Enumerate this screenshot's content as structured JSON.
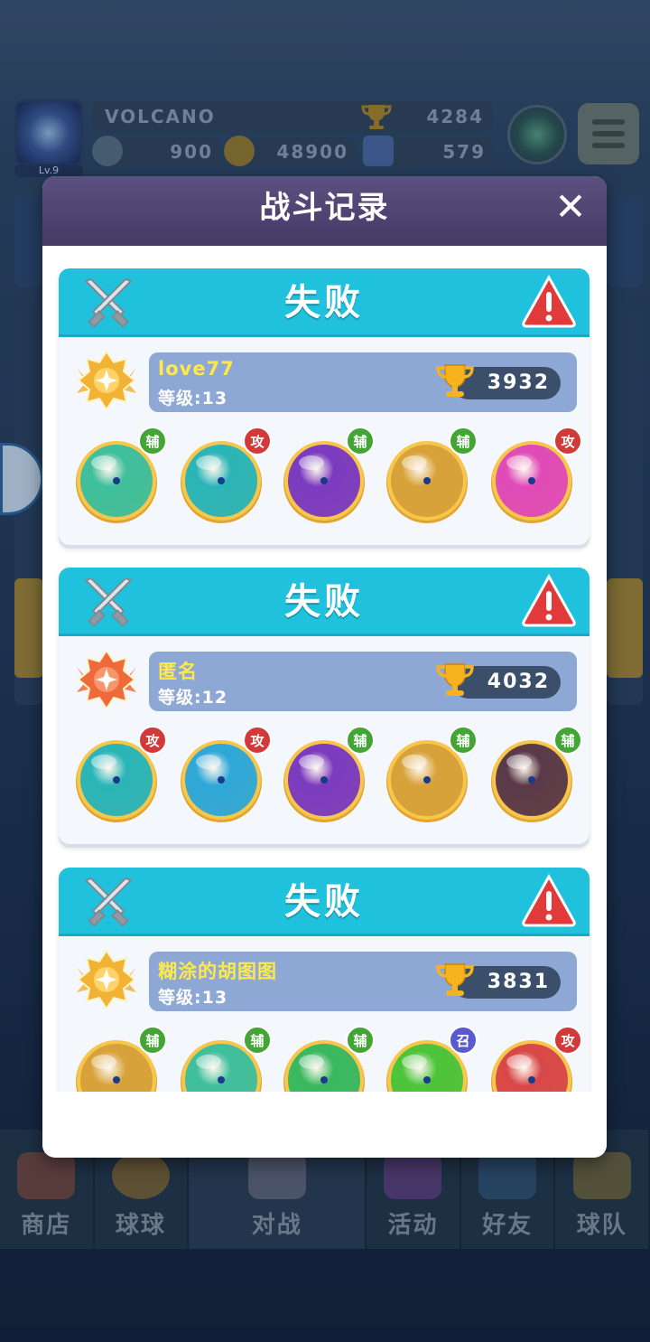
{
  "player": {
    "level": "Lv.9",
    "name": "VOLCANO",
    "trophies": "4284",
    "energy": "900",
    "coins": "48900",
    "gems": "579"
  },
  "nav": [
    {
      "label": "商店"
    },
    {
      "label": "球球"
    },
    {
      "label": "对战"
    },
    {
      "label": "活动"
    },
    {
      "label": "好友"
    },
    {
      "label": "球队"
    }
  ],
  "modal": {
    "title": "战斗记录",
    "close_icon": "close-icon"
  },
  "records": [
    {
      "result": "失败",
      "medal_color": "gold",
      "player_name": "love77",
      "level": "等级:13",
      "trophies": "3932",
      "balls": [
        {
          "icon": "sp-ball",
          "tag": "辅",
          "tag_type": "fu",
          "color": "#3fbf9c"
        },
        {
          "icon": "tornado-ball",
          "tag": "攻",
          "tag_type": "gong",
          "color": "#2bb5b8"
        },
        {
          "icon": "butterfly-ball",
          "tag": "辅",
          "tag_type": "fu",
          "color": "#7b3bc0"
        },
        {
          "icon": "rainbow-ball",
          "tag": "辅",
          "tag_type": "fu",
          "color": "#d8a23a"
        },
        {
          "icon": "shield-ball",
          "tag": "攻",
          "tag_type": "gong",
          "color": "#e04bb8"
        }
      ]
    },
    {
      "result": "失败",
      "medal_color": "orange",
      "player_name": "匿名",
      "level": "等级:12",
      "trophies": "4032",
      "balls": [
        {
          "icon": "tornado-ball",
          "tag": "攻",
          "tag_type": "gong",
          "color": "#2bb5b8"
        },
        {
          "icon": "ice-ball",
          "tag": "攻",
          "tag_type": "gong",
          "color": "#2fa8d8"
        },
        {
          "icon": "butterfly-ball",
          "tag": "辅",
          "tag_type": "fu",
          "color": "#7b3bc0"
        },
        {
          "icon": "rainbow-ball",
          "tag": "辅",
          "tag_type": "fu",
          "color": "#d8a23a"
        },
        {
          "icon": "skull-ball",
          "tag": "辅",
          "tag_type": "fu",
          "color": "#5a3a48"
        }
      ]
    },
    {
      "result": "失败",
      "medal_color": "gold",
      "player_name": "糊涂的胡图图",
      "level": "等级:13",
      "trophies": "3831",
      "balls": [
        {
          "icon": "rainbow-ball",
          "tag": "辅",
          "tag_type": "fu",
          "color": "#d8a23a"
        },
        {
          "icon": "sp-ball",
          "tag": "辅",
          "tag_type": "fu",
          "color": "#3fbf9c"
        },
        {
          "icon": "star-ball",
          "tag": "辅",
          "tag_type": "fu",
          "color": "#39b860"
        },
        {
          "icon": "rune-ball",
          "tag": "召",
          "tag_type": "zhao",
          "color": "#4cc43a"
        },
        {
          "icon": "red-ball",
          "tag": "攻",
          "tag_type": "gong",
          "color": "#d84848"
        }
      ]
    }
  ]
}
